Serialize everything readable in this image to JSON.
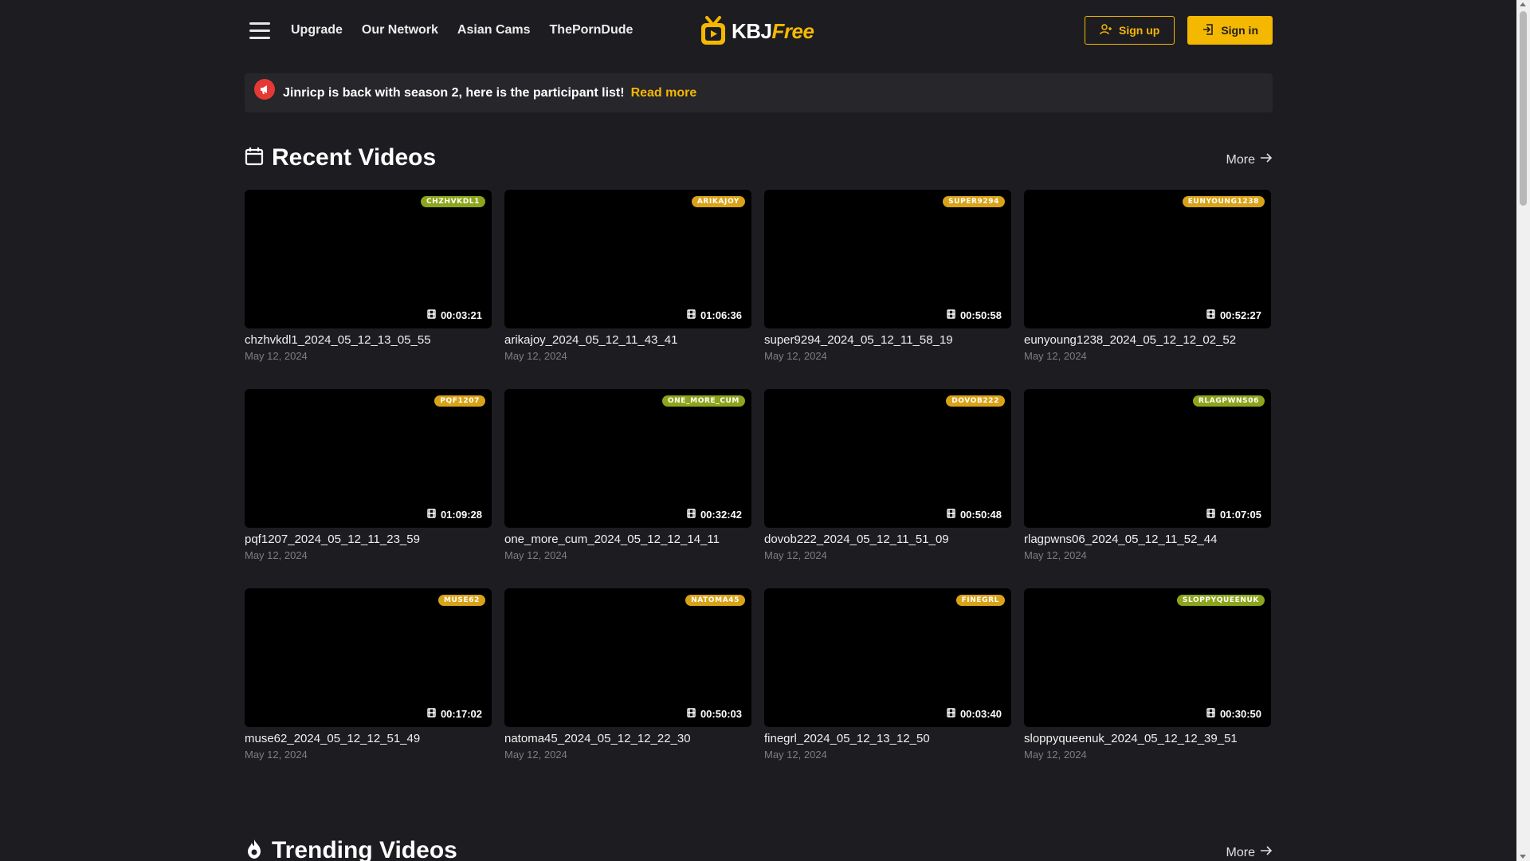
{
  "nav": {
    "links": [
      "Upgrade",
      "Our Network",
      "Asian Cams",
      "ThePornDude"
    ],
    "logo_main": "KBJ",
    "logo_accent": "Free",
    "signup_label": "Sign up",
    "signin_label": "Sign in"
  },
  "announcement": {
    "text": "Jinricp is back with season 2, here is the participant list!",
    "link_label": "Read more"
  },
  "recent": {
    "title": "Recent Videos",
    "more_label": "More",
    "videos": [
      {
        "badge": "CHZHVKDL1",
        "badge_color": "green",
        "duration": "00:03:21",
        "title": "chzhvkdl1_2024_05_12_13_05_55",
        "date": "May 12, 2024"
      },
      {
        "badge": "ARIKAJOY",
        "badge_color": "orange",
        "duration": "01:06:36",
        "title": "arikajoy_2024_05_12_11_43_41",
        "date": "May 12, 2024"
      },
      {
        "badge": "SUPER9294",
        "badge_color": "orange",
        "duration": "00:50:58",
        "title": "super9294_2024_05_12_11_58_19",
        "date": "May 12, 2024"
      },
      {
        "badge": "EUNYOUNG1238",
        "badge_color": "orange",
        "duration": "00:52:27",
        "title": "eunyoung1238_2024_05_12_12_02_52",
        "date": "May 12, 2024"
      },
      {
        "badge": "PQF1207",
        "badge_color": "orange",
        "duration": "01:09:28",
        "title": "pqf1207_2024_05_12_11_23_59",
        "date": "May 12, 2024"
      },
      {
        "badge": "ONE_MORE_CUM",
        "badge_color": "green",
        "duration": "00:32:42",
        "title": "one_more_cum_2024_05_12_12_14_11",
        "date": "May 12, 2024"
      },
      {
        "badge": "DOVOB222",
        "badge_color": "orange",
        "duration": "00:50:48",
        "title": "dovob222_2024_05_12_11_51_09",
        "date": "May 12, 2024"
      },
      {
        "badge": "RLAGPWNS06",
        "badge_color": "green",
        "duration": "01:07:05",
        "title": "rlagpwns06_2024_05_12_11_52_44",
        "date": "May 12, 2024"
      },
      {
        "badge": "MUSE62",
        "badge_color": "orange",
        "duration": "00:17:02",
        "title": "muse62_2024_05_12_12_51_49",
        "date": "May 12, 2024"
      },
      {
        "badge": "NATOMA45",
        "badge_color": "orange",
        "duration": "00:50:03",
        "title": "natoma45_2024_05_12_12_22_30",
        "date": "May 12, 2024"
      },
      {
        "badge": "FINEGRL",
        "badge_color": "orange",
        "duration": "00:03:40",
        "title": "finegrl_2024_05_12_13_12_50",
        "date": "May 12, 2024"
      },
      {
        "badge": "SLOPPYQUEENUK",
        "badge_color": "green",
        "duration": "00:30:50",
        "title": "sloppyqueenuk_2024_05_12_12_39_51",
        "date": "May 12, 2024"
      }
    ]
  },
  "trending": {
    "title": "Trending Videos",
    "more_label": "More"
  },
  "colors": {
    "background": "#1d1d21",
    "accent": "#f5b800",
    "badge_green": "#8ca51c",
    "badge_orange": "#d9a318",
    "alert_red": "#e53935"
  },
  "icons": [
    "menu-icon",
    "play-tv-logo-icon",
    "user-plus-icon",
    "sign-in-icon",
    "megaphone-icon",
    "calendar-icon",
    "arrow-right-icon",
    "film-icon",
    "fire-icon"
  ]
}
